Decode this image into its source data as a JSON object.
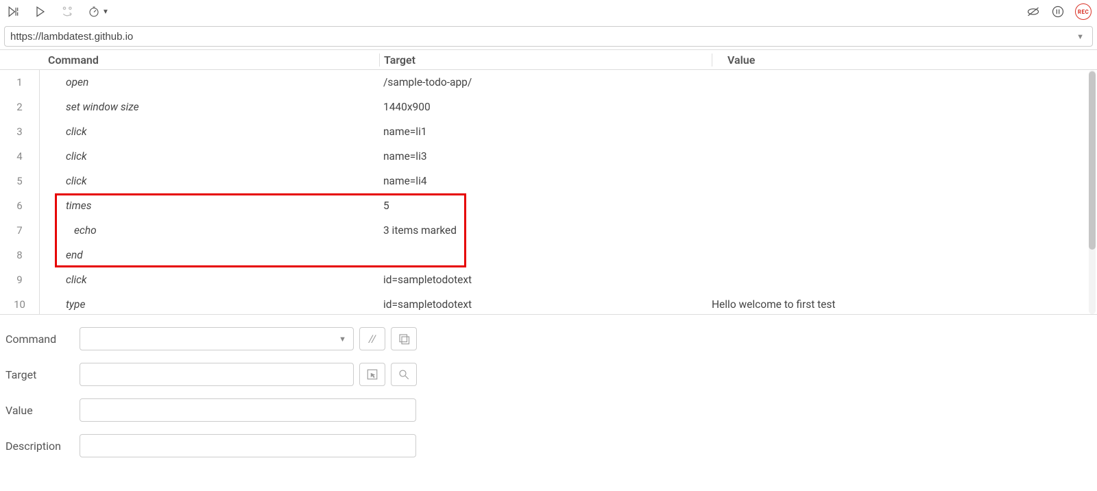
{
  "toolbar": {
    "run_all_label": "Run all",
    "run_current_label": "Run current",
    "step_label": "Step",
    "speed_label": "Speed",
    "disable_bp_label": "Disable breakpoints",
    "pause_label": "Pause",
    "rec_label": "REC"
  },
  "url": "https://lambdatest.github.io",
  "columns": {
    "command": "Command",
    "target": "Target",
    "value": "Value"
  },
  "rows": [
    {
      "n": "1",
      "command": "open",
      "target": "/sample-todo-app/",
      "value": "",
      "indent": false
    },
    {
      "n": "2",
      "command": "set window size",
      "target": "1440x900",
      "value": "",
      "indent": false
    },
    {
      "n": "3",
      "command": "click",
      "target": "name=li1",
      "value": "",
      "indent": false
    },
    {
      "n": "4",
      "command": "click",
      "target": "name=li3",
      "value": "",
      "indent": false
    },
    {
      "n": "5",
      "command": "click",
      "target": "name=li4",
      "value": "",
      "indent": false
    },
    {
      "n": "6",
      "command": "times",
      "target": "5",
      "value": "",
      "indent": false
    },
    {
      "n": "7",
      "command": "echo",
      "target": "3 items marked",
      "value": "",
      "indent": true
    },
    {
      "n": "8",
      "command": "end",
      "target": "",
      "value": "",
      "indent": false
    },
    {
      "n": "9",
      "command": "click",
      "target": "id=sampletodotext",
      "value": "",
      "indent": false
    },
    {
      "n": "10",
      "command": "type",
      "target": "id=sampletodotext",
      "value": "Hello welcome to first test",
      "indent": false
    }
  ],
  "highlight": {
    "top_row_index": 5,
    "row_span": 3
  },
  "editor": {
    "labels": {
      "command": "Command",
      "target": "Target",
      "value": "Value",
      "description": "Description"
    },
    "command": "",
    "target": "",
    "value": "",
    "description": ""
  }
}
